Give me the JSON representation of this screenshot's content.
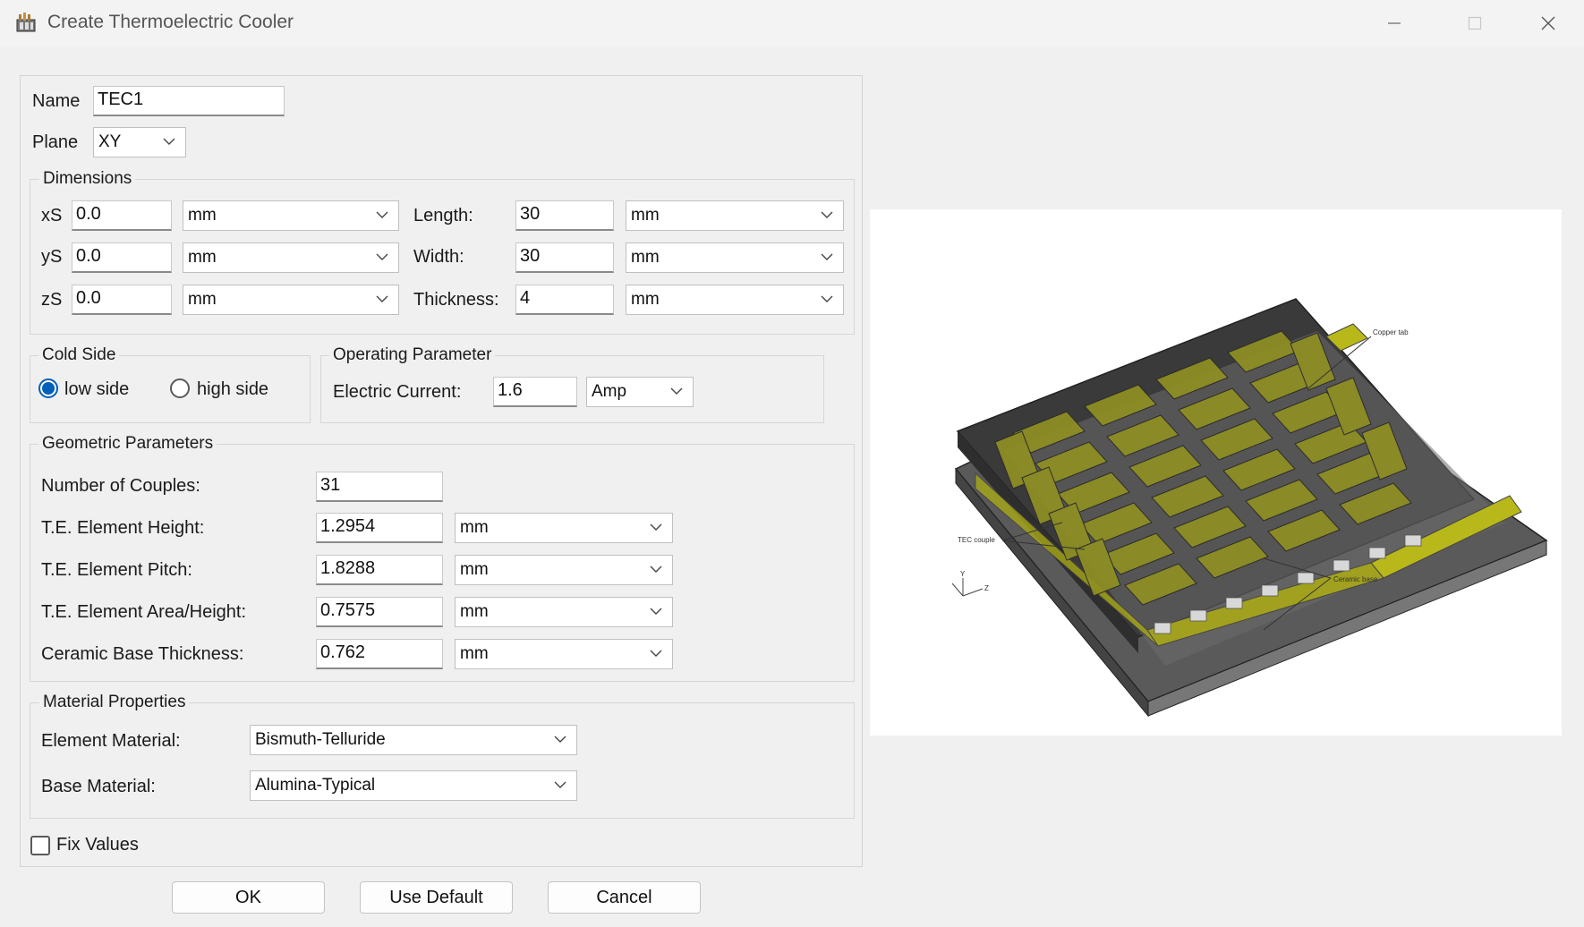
{
  "window": {
    "title": "Create Thermoelectric Cooler",
    "icon": "tec-app-icon",
    "minimize_icon": "minimize-icon",
    "maximize_icon": "maximize-icon",
    "close_icon": "close-icon"
  },
  "name_field": {
    "label": "Name",
    "value": "TEC1"
  },
  "plane_field": {
    "label": "Plane",
    "value": "XY"
  },
  "dimensions": {
    "title": "Dimensions",
    "rows": [
      {
        "label": "xS",
        "value": "0.0",
        "unit": "mm"
      },
      {
        "label": "yS",
        "value": "0.0",
        "unit": "mm"
      },
      {
        "label": "zS",
        "value": "0.0",
        "unit": "mm"
      }
    ],
    "size_rows": [
      {
        "label": "Length:",
        "value": "30",
        "unit": "mm"
      },
      {
        "label": "Width:",
        "value": "30",
        "unit": "mm"
      },
      {
        "label": "Thickness:",
        "value": "4",
        "unit": "mm"
      }
    ]
  },
  "cold_side": {
    "title": "Cold Side",
    "options": [
      "low side",
      "high side"
    ],
    "selected": "low side"
  },
  "operating": {
    "title": "Operating Parameter",
    "current_label": "Electric Current:",
    "current_value": "1.6",
    "current_unit": "Amp"
  },
  "geometric": {
    "title": "Geometric Parameters",
    "couples_label": "Number of Couples:",
    "couples_value": "31",
    "rows": [
      {
        "label": "T.E. Element Height:",
        "value": "1.2954",
        "unit": "mm"
      },
      {
        "label": "T.E. Element Pitch:",
        "value": "1.8288",
        "unit": "mm"
      },
      {
        "label": "T.E. Element Area/Height:",
        "value": "0.7575",
        "unit": "mm"
      },
      {
        "label": "Ceramic Base Thickness:",
        "value": "0.762",
        "unit": "mm"
      }
    ]
  },
  "material": {
    "title": "Material Properties",
    "element_label": "Element Material:",
    "element_value": "Bismuth-Telluride",
    "base_label": "Base Material:",
    "base_value": "Alumina-Typical"
  },
  "fix_values": {
    "label": "Fix Values",
    "checked": false
  },
  "buttons": {
    "ok": "OK",
    "use_default": "Use Default",
    "cancel": "Cancel"
  },
  "preview": {
    "annotations": {
      "copper_tab": "Copper tab",
      "tec_couple": "TEC couple",
      "ceramic_base": "Ceramic base",
      "axis_y": "Y",
      "axis_z": "Z"
    }
  },
  "colors": {
    "accent": "#005fb8",
    "element_fill": "#9a9a2a",
    "base_dark": "#3a3a3a"
  }
}
